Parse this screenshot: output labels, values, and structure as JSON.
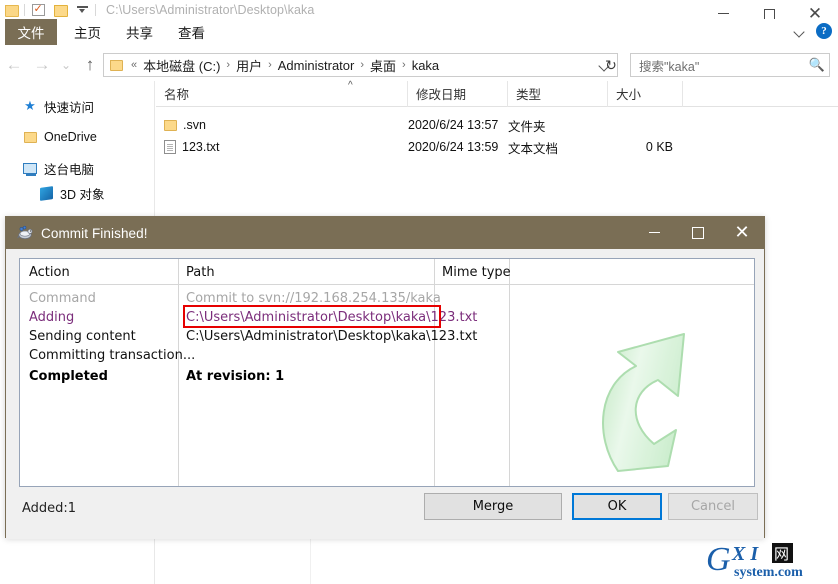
{
  "explorer": {
    "quick_access": {
      "path_text": "C:\\Users\\Administrator\\Desktop\\kaka",
      "icons": [
        "folder-icon",
        "checkbox-checked-icon",
        "folder-icon",
        "dropdown-caret-icon"
      ]
    },
    "window_controls": {
      "minimize": "minimize-icon",
      "maximize": "maximize-icon",
      "close": "close-icon"
    },
    "ribbon": {
      "file_tab": "文件",
      "tabs": [
        "主页",
        "共享",
        "查看"
      ],
      "collapse": "chevron-down-icon",
      "help": "?"
    },
    "address": {
      "back": "←",
      "forward": "→",
      "recent": "⌄",
      "up": "↑",
      "root_icon": "folder-icon",
      "overflow": "«",
      "crumbs": [
        "本地磁盘 (C:)",
        "用户",
        "Administrator",
        "桌面",
        "kaka"
      ],
      "dropdown": "chevron-down-icon",
      "refresh": "↻"
    },
    "search": {
      "placeholder": "搜索\"kaka\"",
      "icon": "search-icon"
    },
    "nav_pane": {
      "items": [
        {
          "label": "快速访问",
          "icon": "star-pin-icon",
          "indent": false
        },
        {
          "label": "OneDrive",
          "icon": "folder-icon",
          "indent": false
        },
        {
          "label": "这台电脑",
          "icon": "computer-icon",
          "indent": false
        },
        {
          "label": "3D 对象",
          "icon": "3d-objects-icon",
          "indent": true
        }
      ]
    },
    "file_list": {
      "columns": [
        "名称",
        "修改日期",
        "类型",
        "大小"
      ],
      "sort_indicator": "^",
      "rows": [
        {
          "name": ".svn",
          "icon": "folder-icon",
          "date": "2020/6/24 13:57",
          "type": "文件夹",
          "size": ""
        },
        {
          "name": "123.txt",
          "icon": "text-document-icon",
          "date": "2020/6/24 13:59",
          "type": "文本文档",
          "size": "0 KB"
        }
      ]
    }
  },
  "dialog": {
    "title": "Commit Finished!",
    "title_icon": "tortoisesvn-icon",
    "controls": {
      "minimize": "minimize-icon",
      "maximize": "maximize-icon",
      "close": "close-icon"
    },
    "list": {
      "headers": [
        "Action",
        "Path",
        "Mime type"
      ],
      "rows": [
        {
          "action": "Command",
          "path": "Commit to svn://192.168.254.135/kaka",
          "mime": "",
          "style": "gray"
        },
        {
          "action": "Adding",
          "path": "C:\\Users\\Administrator\\Desktop\\kaka\\123.txt",
          "mime": "",
          "style": "purple",
          "highlight": true
        },
        {
          "action": "Sending content",
          "path": "C:\\Users\\Administrator\\Desktop\\kaka\\123.txt",
          "mime": "",
          "style": "dark"
        },
        {
          "action": "Committing transaction...",
          "path": "",
          "mime": "",
          "style": "dark"
        },
        {
          "action": "Completed",
          "path": "At revision: 1",
          "mime": "",
          "style": "bold"
        }
      ]
    },
    "watermark_icon": "green-curved-arrow-icon",
    "status": "Added:1",
    "buttons": {
      "merge": "Merge",
      "ok": "OK",
      "cancel": "Cancel"
    },
    "colors": {
      "titlebar": "#7a6e55",
      "highlight": "#e60000",
      "accent": "#0078d7",
      "purple": "#7b2d7b"
    }
  },
  "watermark": {
    "primary": "GXI",
    "cjk": "网",
    "secondary": "system.com",
    "color": "#1b5faa"
  }
}
